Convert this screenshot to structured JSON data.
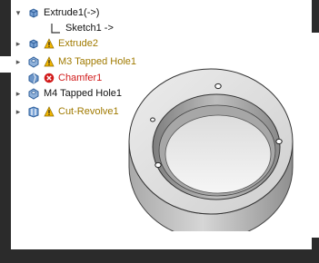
{
  "tree": {
    "rows": [
      {
        "caret": "▾",
        "label": "Extrude1(->)",
        "status": "normal",
        "icon": "extrude-feature-icon"
      },
      {
        "caret": "",
        "label": "Sketch1 ->",
        "status": "normal",
        "icon": "sketch-icon"
      },
      {
        "caret": "▸",
        "label": "Extrude2",
        "status": "warning",
        "icon": "extrude-feature-icon"
      },
      {
        "caret": "▸",
        "label": "M3 Tapped Hole1",
        "status": "warning",
        "icon": "hole-wizard-icon"
      },
      {
        "caret": "",
        "label": "Chamfer1",
        "status": "error",
        "icon": "chamfer-icon"
      },
      {
        "caret": "▸",
        "label": "M4 Tapped Hole1",
        "status": "normal",
        "icon": "hole-wizard-icon"
      },
      {
        "caret": "▸",
        "label": "Cut-Revolve1",
        "status": "warning",
        "icon": "cut-revolve-icon"
      }
    ]
  },
  "colors": {
    "warning": "#f2b600",
    "error": "#d11b1b",
    "warning_text": "#a07a00",
    "error_text": "#d11b1b",
    "frame": "#2b2b2b"
  },
  "model": {
    "icon": "ring-part-model"
  }
}
